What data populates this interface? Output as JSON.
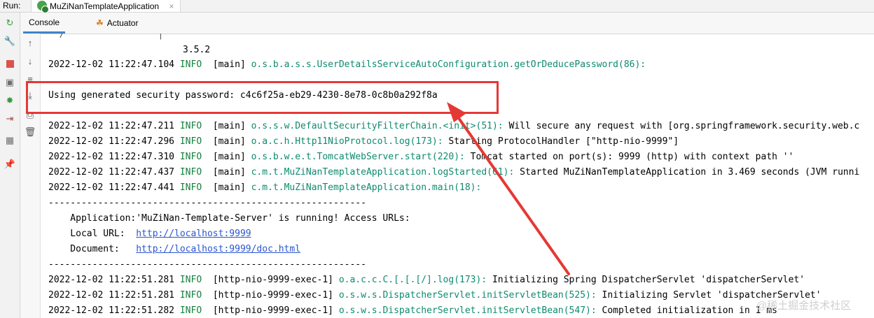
{
  "run_bar": {
    "label": "Run:",
    "tab_title": "MuZiNanTemplateApplication",
    "close": "×"
  },
  "tabs": [
    {
      "label": "Console",
      "active": true
    },
    {
      "label": "Actuator",
      "active": false
    }
  ],
  "toolbar_icons": [
    "rerun-icon",
    "wrench-icon",
    "stop-icon",
    "camera-icon",
    "debug-icon",
    "exit-icon",
    "layout-icon",
    "pin-icon"
  ],
  "gutter_icons": [
    "arrow-up-icon",
    "arrow-down-icon",
    "soft-wrap-icon",
    "scroll-to-end-icon",
    "print-icon",
    "trash-icon"
  ],
  "console": {
    "banner_fragment": "  /                 |",
    "version": "3.5.2",
    "log_prefix": "2022-12-02 11:22:47.104 INFO  [main]",
    "lines": [
      {
        "ts": "2022-12-02 11:22:47.104",
        "level": "INFO",
        "thread": "[main]",
        "logger": "o.s.b.a.s.s.UserDetailsServiceAutoConfiguration.getOrDeducePassword(86):",
        "msg": ""
      },
      {
        "ts": "2022-12-02 11:22:47.211",
        "level": "INFO",
        "thread": "[main]",
        "logger": "o.s.s.w.DefaultSecurityFilterChain.<init>(51):",
        "msg": " Will secure any request with [org.springframework.security.web.c"
      },
      {
        "ts": "2022-12-02 11:22:47.296",
        "level": "INFO",
        "thread": "[main]",
        "logger": "o.a.c.h.Http11NioProtocol.log(173):",
        "msg": " Starting ProtocolHandler [\"http-nio-9999\"]"
      },
      {
        "ts": "2022-12-02 11:22:47.310",
        "level": "INFO",
        "thread": "[main]",
        "logger": "o.s.b.w.e.t.TomcatWebServer.start(220):",
        "msg": " Tomcat started on port(s): 9999 (http) with context path ''"
      },
      {
        "ts": "2022-12-02 11:22:47.437",
        "level": "INFO",
        "thread": "[main]",
        "logger": "c.m.t.MuZiNanTemplateApplication.logStarted(61):",
        "msg": " Started MuZiNanTemplateApplication in 3.469 seconds (JVM runni"
      },
      {
        "ts": "2022-12-02 11:22:47.441",
        "level": "INFO",
        "thread": "[main]",
        "logger": "c.m.t.MuZiNanTemplateApplication.main(18):",
        "msg": ""
      },
      {
        "ts": "2022-12-02 11:22:51.281",
        "level": "INFO",
        "thread": "[http-nio-9999-exec-1]",
        "logger": "o.a.c.c.C.[.[.[/].log(173):",
        "msg": " Initializing Spring DispatcherServlet 'dispatcherServlet'"
      },
      {
        "ts": "2022-12-02 11:22:51.281",
        "level": "INFO",
        "thread": "[http-nio-9999-exec-1]",
        "logger": "o.s.w.s.DispatcherServlet.initServletBean(525):",
        "msg": " Initializing Servlet 'dispatcherServlet'"
      },
      {
        "ts": "2022-12-02 11:22:51.282",
        "level": "INFO",
        "thread": "[http-nio-9999-exec-1]",
        "logger": "o.s.w.s.DispatcherServlet.initServletBean(547):",
        "msg": " Completed initialization in 1 ms"
      }
    ],
    "password_line": "Using generated security password: c4c6f25a-eb29-4230-8e78-0c8b0a292f8a",
    "separator": "----------------------------------------------------------",
    "app_running": "    Application:'MuZiNan-Template-Server' is running! Access URLs:",
    "local_label": "    Local URL:  ",
    "local_url": "http://localhost:9999",
    "doc_label": "    Document:   ",
    "doc_url": "http://localhost:9999/doc.html"
  },
  "annotation_color": "#e53935",
  "watermark": "@稀土掘金技术社区"
}
